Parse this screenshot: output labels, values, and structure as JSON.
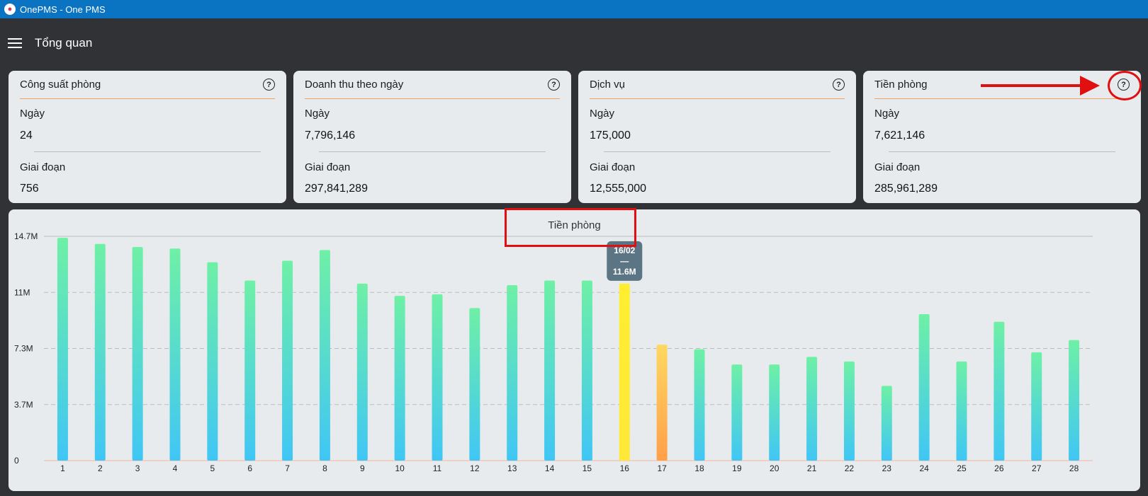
{
  "window": {
    "title": "OnePMS - One PMS"
  },
  "appbar": {
    "title": "Tổng quan"
  },
  "cards": [
    {
      "title": "Công suất phòng",
      "day_label": "Ngày",
      "day_value": "24",
      "period_label": "Giai đoạn",
      "period_value": "756"
    },
    {
      "title": "Doanh thu theo ngày",
      "day_label": "Ngày",
      "day_value": "7,796,146",
      "period_label": "Giai đoạn",
      "period_value": "297,841,289"
    },
    {
      "title": "Dịch vụ",
      "day_label": "Ngày",
      "day_value": "175,000",
      "period_label": "Giai đoạn",
      "period_value": "12,555,000"
    },
    {
      "title": "Tiền phòng",
      "day_label": "Ngày",
      "day_value": "7,621,146",
      "period_label": "Giai đoạn",
      "period_value": "285,961,289"
    }
  ],
  "chart_data": {
    "type": "bar",
    "title": "Tiền phòng",
    "categories": [
      "1",
      "2",
      "3",
      "4",
      "5",
      "6",
      "7",
      "8",
      "9",
      "10",
      "11",
      "12",
      "13",
      "14",
      "15",
      "16",
      "17",
      "18",
      "19",
      "20",
      "21",
      "22",
      "23",
      "24",
      "25",
      "26",
      "27",
      "28"
    ],
    "values": [
      14.6,
      14.2,
      14.0,
      13.9,
      13.0,
      11.8,
      13.1,
      13.8,
      11.6,
      10.8,
      10.9,
      10.0,
      11.5,
      11.8,
      11.8,
      11.6,
      7.6,
      7.3,
      6.3,
      6.3,
      6.8,
      6.5,
      4.9,
      9.6,
      6.5,
      9.1,
      7.1,
      7.9
    ],
    "ylim": [
      0,
      14.7
    ],
    "y_ticks": [
      "0",
      "3.7M",
      "7.3M",
      "11M",
      "14.7M"
    ],
    "grid": true,
    "highlight_index": 15,
    "tooltip": {
      "date": "16/02",
      "sep": "—",
      "value": "11.6M"
    },
    "colors": {
      "bar_top": "#6ef0a6",
      "bar_bottom": "#40c6f5",
      "highlight_top": "#ffee30",
      "highlight_bottom": "#ffe838",
      "today_top": "#ffd860",
      "today_bottom": "#ff9f4a",
      "tooltip_bg": "#5c7585"
    },
    "today_index": 16
  }
}
